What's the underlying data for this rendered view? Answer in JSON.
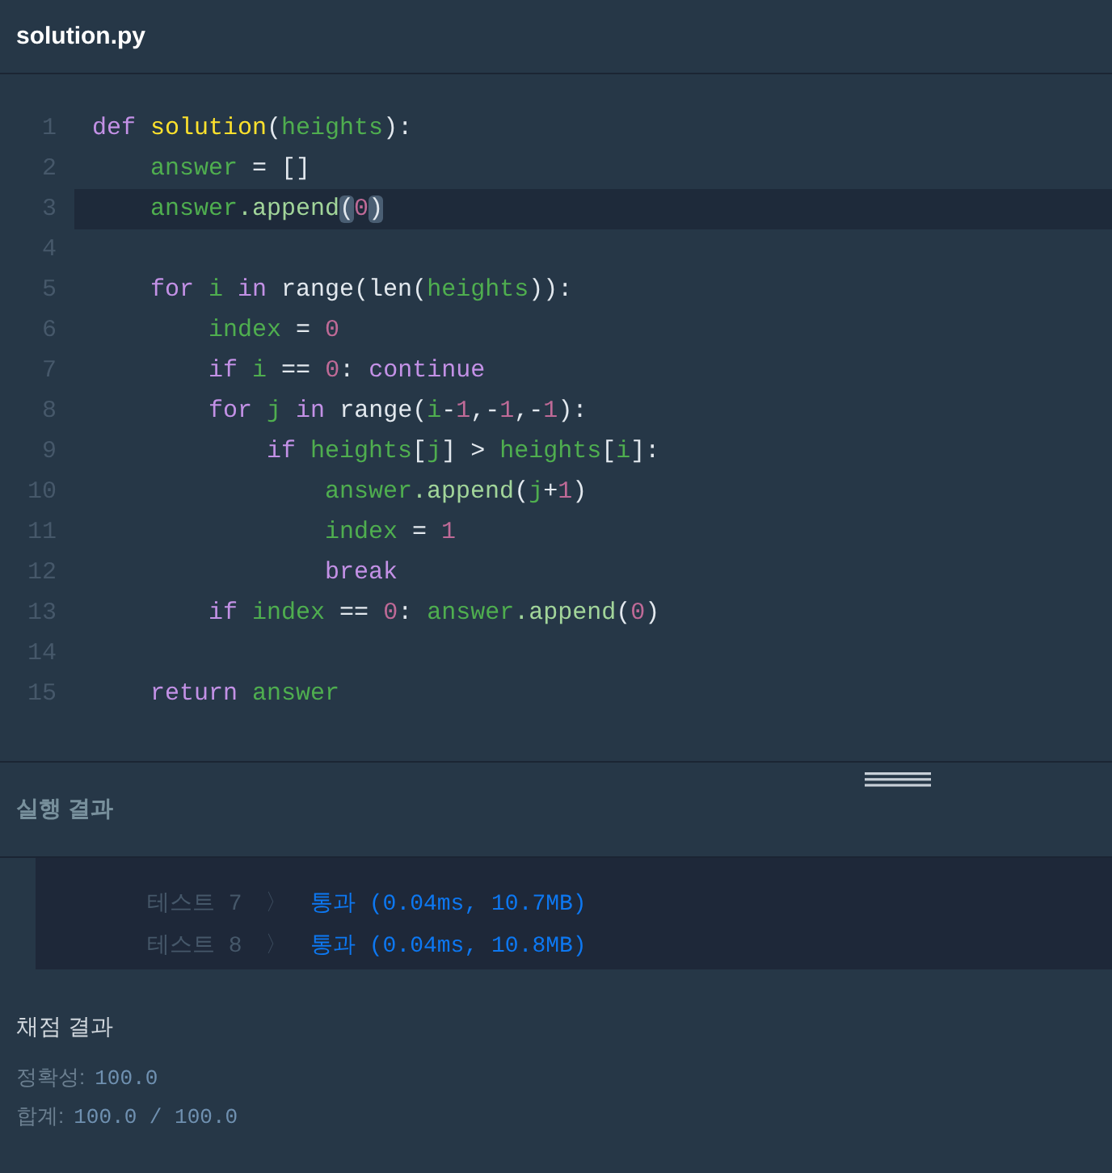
{
  "file_tab": {
    "title": "solution.py"
  },
  "editor": {
    "lines": [
      {
        "number": "1",
        "selected": false,
        "tokens": [
          {
            "text": "def ",
            "kind": "kw"
          },
          {
            "text": "solution",
            "kind": "fn"
          },
          {
            "text": "(",
            "kind": "plain"
          },
          {
            "text": "heights",
            "kind": "var"
          },
          {
            "text": "):",
            "kind": "plain"
          }
        ]
      },
      {
        "number": "2",
        "selected": false,
        "tokens": [
          {
            "text": "    answer",
            "kind": "var"
          },
          {
            "text": " = []",
            "kind": "plain"
          }
        ]
      },
      {
        "number": "3",
        "selected": true,
        "tokens": [
          {
            "text": "    answer",
            "kind": "var"
          },
          {
            "text": ".append",
            "kind": "method"
          },
          {
            "text": "(",
            "kind": "match"
          },
          {
            "text": "0",
            "kind": "num"
          },
          {
            "text": ")",
            "kind": "match"
          }
        ]
      },
      {
        "number": "4",
        "selected": false
      },
      {
        "number": "5",
        "selected": false,
        "tokens": [
          {
            "text": "    for ",
            "kind": "kw"
          },
          {
            "text": "i ",
            "kind": "var"
          },
          {
            "text": "in",
            "kind": "kw"
          },
          {
            "text": " range(len(",
            "kind": "plain"
          },
          {
            "text": "heights",
            "kind": "var"
          },
          {
            "text": ")):",
            "kind": "plain"
          }
        ]
      },
      {
        "number": "6",
        "selected": false,
        "tokens": [
          {
            "text": "        index",
            "kind": "var"
          },
          {
            "text": " = ",
            "kind": "plain"
          },
          {
            "text": "0",
            "kind": "num"
          }
        ]
      },
      {
        "number": "7",
        "selected": false,
        "tokens": [
          {
            "text": "        if ",
            "kind": "kw"
          },
          {
            "text": "i",
            "kind": "var"
          },
          {
            "text": " == ",
            "kind": "plain"
          },
          {
            "text": "0",
            "kind": "num"
          },
          {
            "text": ": ",
            "kind": "plain"
          },
          {
            "text": "continue",
            "kind": "kw"
          }
        ]
      },
      {
        "number": "8",
        "selected": false,
        "tokens": [
          {
            "text": "        for ",
            "kind": "kw"
          },
          {
            "text": "j ",
            "kind": "var"
          },
          {
            "text": "in",
            "kind": "kw"
          },
          {
            "text": " range(",
            "kind": "plain"
          },
          {
            "text": "i",
            "kind": "var"
          },
          {
            "text": "-",
            "kind": "plain"
          },
          {
            "text": "1",
            "kind": "num"
          },
          {
            "text": ",-",
            "kind": "plain"
          },
          {
            "text": "1",
            "kind": "num"
          },
          {
            "text": ",-",
            "kind": "plain"
          },
          {
            "text": "1",
            "kind": "num"
          },
          {
            "text": "):",
            "kind": "plain"
          }
        ]
      },
      {
        "number": "9",
        "selected": false,
        "tokens": [
          {
            "text": "            if ",
            "kind": "kw"
          },
          {
            "text": "heights",
            "kind": "var"
          },
          {
            "text": "[",
            "kind": "plain"
          },
          {
            "text": "j",
            "kind": "var"
          },
          {
            "text": "] > ",
            "kind": "plain"
          },
          {
            "text": "heights",
            "kind": "var"
          },
          {
            "text": "[",
            "kind": "plain"
          },
          {
            "text": "i",
            "kind": "var"
          },
          {
            "text": "]:",
            "kind": "plain"
          }
        ]
      },
      {
        "number": "10",
        "selected": false,
        "tokens": [
          {
            "text": "                answer",
            "kind": "var"
          },
          {
            "text": ".append",
            "kind": "method"
          },
          {
            "text": "(",
            "kind": "plain"
          },
          {
            "text": "j",
            "kind": "var"
          },
          {
            "text": "+",
            "kind": "plain"
          },
          {
            "text": "1",
            "kind": "num"
          },
          {
            "text": ")",
            "kind": "plain"
          }
        ]
      },
      {
        "number": "11",
        "selected": false,
        "tokens": [
          {
            "text": "                index",
            "kind": "var"
          },
          {
            "text": " = ",
            "kind": "plain"
          },
          {
            "text": "1",
            "kind": "num"
          }
        ]
      },
      {
        "number": "12",
        "selected": false,
        "tokens": [
          {
            "text": "                break",
            "kind": "kw"
          }
        ]
      },
      {
        "number": "13",
        "selected": false,
        "tokens": [
          {
            "text": "        if ",
            "kind": "kw"
          },
          {
            "text": "index",
            "kind": "var"
          },
          {
            "text": " == ",
            "kind": "plain"
          },
          {
            "text": "0",
            "kind": "num"
          },
          {
            "text": ": ",
            "kind": "plain"
          },
          {
            "text": "answer",
            "kind": "var"
          },
          {
            "text": ".append",
            "kind": "method"
          },
          {
            "text": "(",
            "kind": "plain"
          },
          {
            "text": "0",
            "kind": "num"
          },
          {
            "text": ")",
            "kind": "plain"
          }
        ]
      },
      {
        "number": "14",
        "selected": false
      },
      {
        "number": "15",
        "selected": false,
        "tokens": [
          {
            "text": "    return ",
            "kind": "kw"
          },
          {
            "text": "answer",
            "kind": "var"
          }
        ]
      }
    ]
  },
  "run_result": {
    "title": "실행 결과",
    "tests": [
      {
        "label": "테스트 7",
        "chevron": "〉",
        "result": "통과 (0.04ms, 10.7MB)"
      },
      {
        "label": "테스트 8",
        "chevron": "〉",
        "result": "통과 (0.04ms, 10.8MB)"
      }
    ]
  },
  "grading": {
    "title": "채점 결과",
    "rows": [
      {
        "label": "정확성:",
        "value": "100.0"
      },
      {
        "label": "합계:",
        "value": "100.0 / 100.0"
      }
    ]
  }
}
